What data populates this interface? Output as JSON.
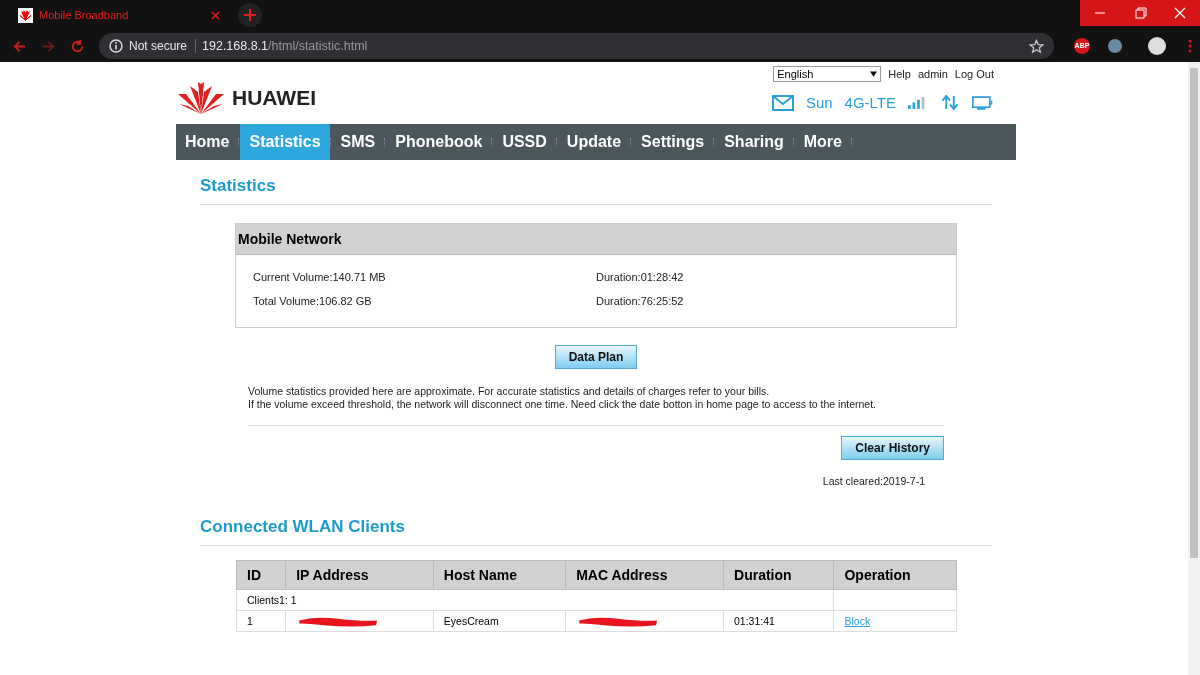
{
  "browser": {
    "tab_title": "Mobile Broadband",
    "security": "Not secure",
    "url_host": "192.168.8.1",
    "url_path": "/html/statistic.html",
    "extension_badge": "ABP"
  },
  "header": {
    "brand": "HUAWEI",
    "language": "English",
    "links": [
      "Help",
      "admin",
      "Log Out"
    ],
    "operator": "Sun",
    "network": "4G-LTE"
  },
  "nav": [
    {
      "label": "Home",
      "selected": false
    },
    {
      "label": "Statistics",
      "selected": true
    },
    {
      "label": "SMS",
      "selected": false
    },
    {
      "label": "Phonebook",
      "selected": false
    },
    {
      "label": "USSD",
      "selected": false
    },
    {
      "label": "Update",
      "selected": false
    },
    {
      "label": "Settings",
      "selected": false
    },
    {
      "label": "Sharing",
      "selected": false
    },
    {
      "label": "More",
      "selected": false
    }
  ],
  "statistics": {
    "title": "Statistics",
    "panel_title": "Mobile Network",
    "rows": [
      {
        "volume": "Current Volume:140.71 MB",
        "duration": "Duration:01:28:42"
      },
      {
        "volume": "Total Volume:106.82 GB",
        "duration": "Duration:76:25:52"
      }
    ],
    "data_plan_button": "Data Plan",
    "notes": [
      "Volume statistics provided here are approximate. For accurate statistics and details of charges refer to your bills.",
      "If the volume exceed threshold, the network will disconnect one time. Need click the date botton in home page to access to the internet."
    ],
    "clear_button": "Clear History",
    "last_cleared": "Last cleared:2019-7-1"
  },
  "clients": {
    "title": "Connected WLAN Clients",
    "columns": [
      "ID",
      "IP Address",
      "Host Name",
      "MAC Address",
      "Duration",
      "Operation"
    ],
    "group_label": "Clients1: 1",
    "rows": [
      {
        "cells": [
          {
            "kind": "text",
            "text": "1"
          },
          {
            "kind": "redacted"
          },
          {
            "kind": "text",
            "text": "EyesCream"
          },
          {
            "kind": "redacted"
          },
          {
            "kind": "text",
            "text": "01:31:41"
          },
          {
            "kind": "link",
            "text": "Block"
          }
        ]
      }
    ]
  }
}
